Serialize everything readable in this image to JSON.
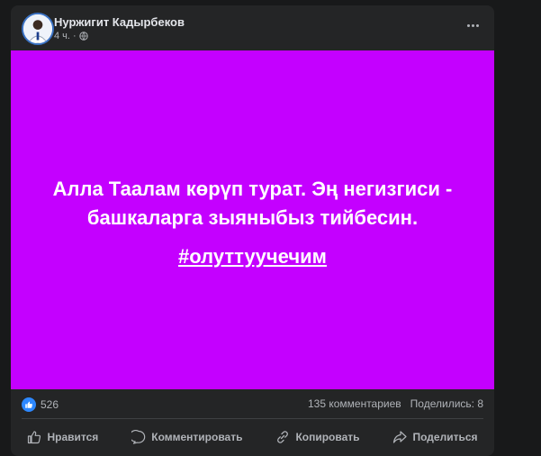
{
  "post": {
    "author": "Нуржигит Кадырбеков",
    "time": "4 ч.",
    "separator": "·",
    "message": "Алла Таалам көрүп турат. Эң негизгиси - башкаларга зыяныбыз тийбесин.",
    "hashtag": "#олуттуучечим",
    "background_color": "#c400ff"
  },
  "stats": {
    "reactions": "526",
    "comments": "135 комментариев",
    "shares": "Поделились: 8"
  },
  "actions": {
    "like": "Нравится",
    "comment": "Комментировать",
    "copy": "Копировать",
    "share": "Поделиться"
  },
  "icons": {
    "more": "more-options-icon",
    "globe": "globe-icon",
    "like": "thumbs-up-icon",
    "comment": "comment-icon",
    "copy": "link-icon",
    "share": "share-icon"
  }
}
